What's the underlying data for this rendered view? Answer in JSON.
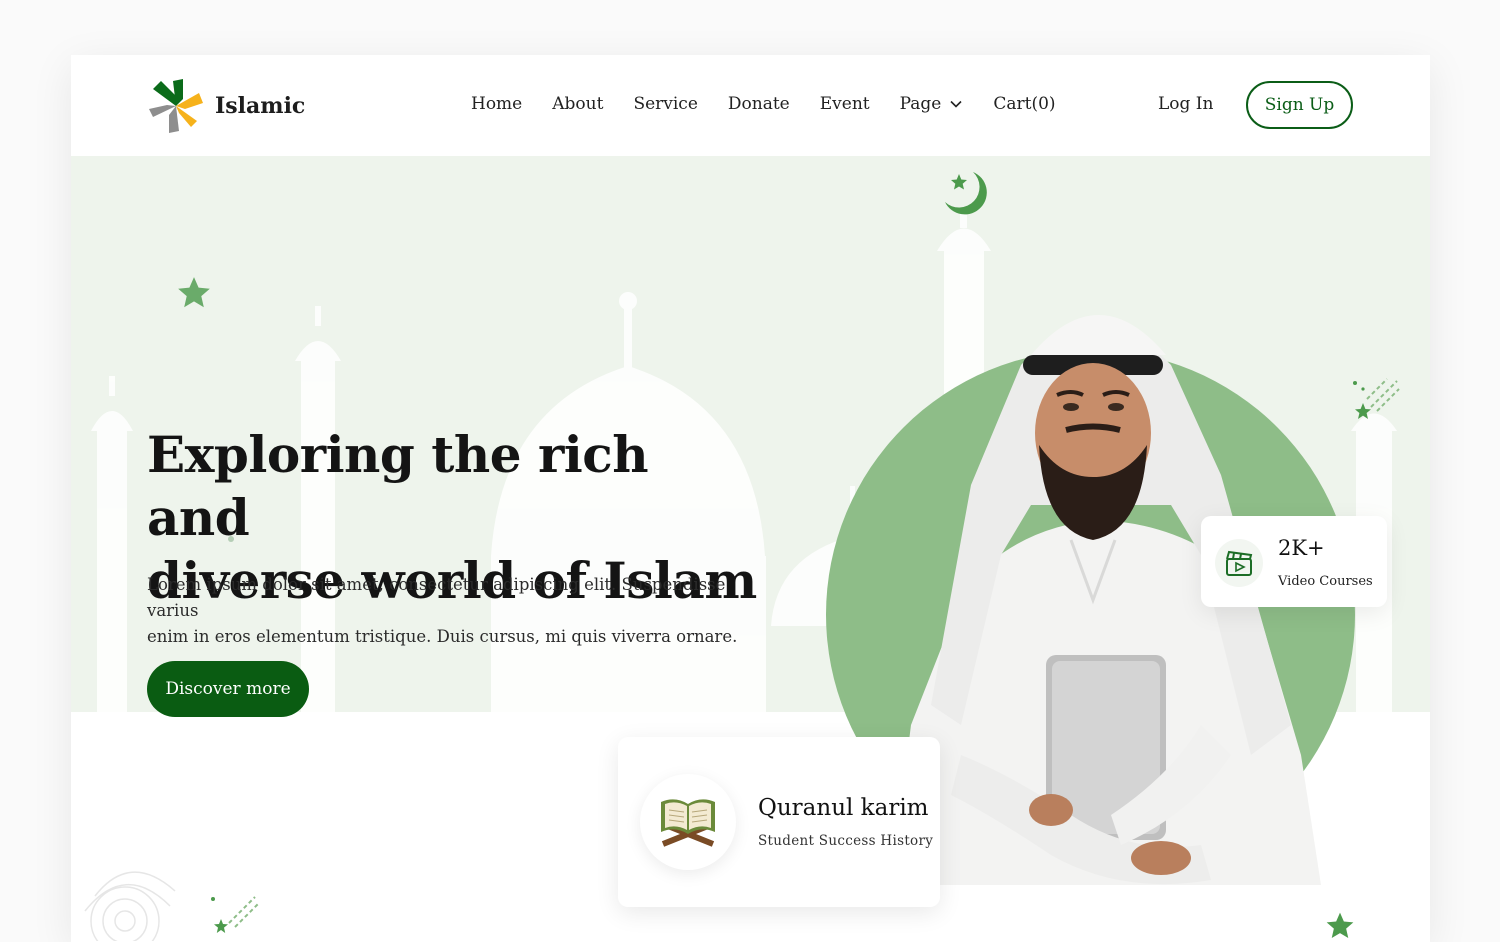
{
  "brand": {
    "name": "Islamic"
  },
  "nav": {
    "items": [
      {
        "label": "Home"
      },
      {
        "label": "About"
      },
      {
        "label": "Service"
      },
      {
        "label": "Donate"
      },
      {
        "label": "Event"
      },
      {
        "label": "Page",
        "has_dropdown": true
      },
      {
        "label": "Cart(0)"
      }
    ],
    "login_label": "Log In",
    "signup_label": "Sign Up"
  },
  "hero": {
    "title_line1": "Exploring the rich and",
    "title_line2": "diverse world of Islam",
    "description_line1": "Lorem ipsum dolor sit amet, consectetur adipiscing elit. Suspendisse varius",
    "description_line2": "enim in eros elementum tristique. Duis cursus, mi quis viverra ornare.",
    "cta_label": "Discover more"
  },
  "stats": {
    "courses_value": "2K+",
    "courses_label": "Video Courses",
    "quran_title": "Quranul karim",
    "quran_subtitle": "Student Success History"
  },
  "icons": {
    "logo": "pinwheel-logo-icon",
    "page_dropdown": "chevron-down-icon",
    "courses": "video-clapper-icon",
    "quran": "open-quran-book-icon",
    "decor": [
      "star-icon",
      "crescent-moon-star-icon",
      "shooting-stars-icon",
      "mosque-silhouette-icon"
    ]
  },
  "colors": {
    "brand_green": "#0a5c12",
    "accent_green": "#8ebd88",
    "hero_bg": "#eef4ec",
    "logo_yellow": "#f6b21b",
    "logo_gray": "#8e8e8e"
  }
}
